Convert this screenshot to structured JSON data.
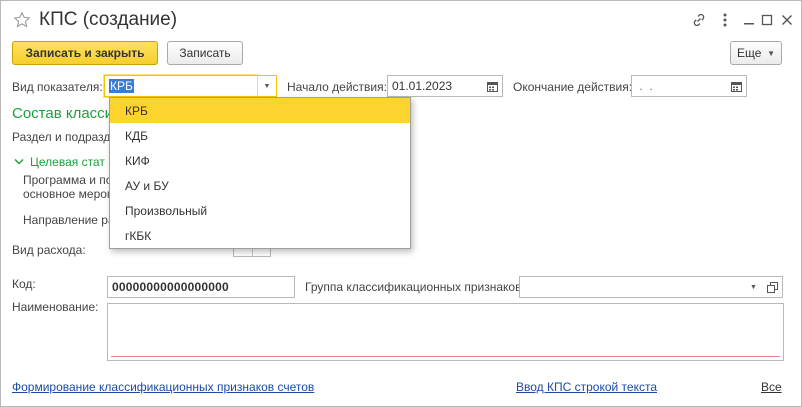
{
  "window": {
    "title": "КПС (создание)"
  },
  "toolbar": {
    "save_close_label": "Записать и закрыть",
    "save_label": "Записать",
    "more_label": "Еще"
  },
  "form": {
    "indicator_type": {
      "label": "Вид показателя:",
      "value": "КРБ"
    },
    "start_date": {
      "label": "Начало действия:",
      "value": "01.01.2023"
    },
    "end_date": {
      "label": "Окончание действия:",
      "value": " .  ."
    },
    "section_title": "Состав класси",
    "section_line": "Раздел и подразд",
    "target_group": "Целевая стат",
    "program_line1": "Программа и по",
    "program_line2": "основное мероп",
    "direction_label": "Направление ра",
    "expense_type_label": "Вид расхода:",
    "code": {
      "label": "Код:",
      "value": "00000000000000000"
    },
    "group": {
      "label": "Группа классификационных признаков:",
      "value": ""
    },
    "name": {
      "label": "Наименование:",
      "value": ""
    }
  },
  "dropdown": {
    "items": [
      "КРБ",
      "КДБ",
      "КИФ",
      "АУ и БУ",
      "Произвольный",
      "гКБК"
    ],
    "active_index": 0
  },
  "footer": {
    "link_accounts": "Формирование классификационных признаков счетов",
    "link_text_input": "Ввод КПС строкой текста",
    "link_all": "Все"
  },
  "colors": {
    "accent_yellow": "#f5cf2a",
    "section_green": "#1e9e3c",
    "link_blue": "#1c4ba6"
  }
}
